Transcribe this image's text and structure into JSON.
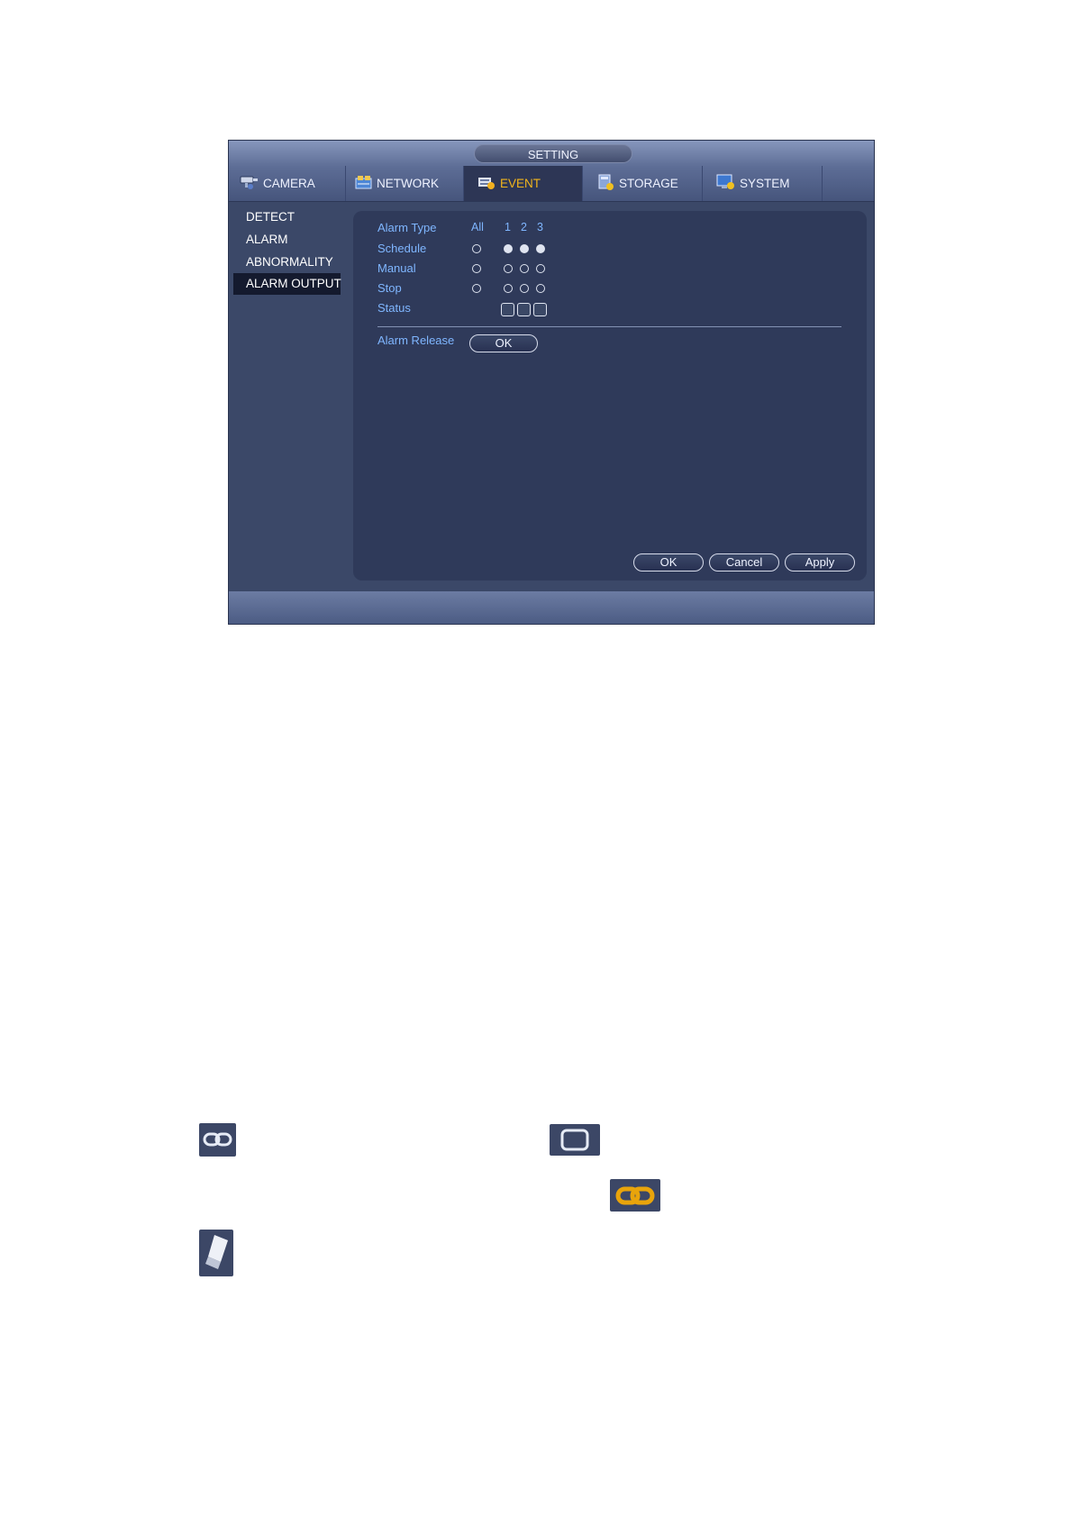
{
  "window": {
    "title": "SETTING"
  },
  "tabs": [
    {
      "label": "CAMERA",
      "icon": "camera-icon"
    },
    {
      "label": "NETWORK",
      "icon": "network-icon"
    },
    {
      "label": "EVENT",
      "icon": "event-icon",
      "active": true
    },
    {
      "label": "STORAGE",
      "icon": "storage-icon"
    },
    {
      "label": "SYSTEM",
      "icon": "system-icon"
    }
  ],
  "sidebar": {
    "items": [
      {
        "label": "DETECT"
      },
      {
        "label": "ALARM"
      },
      {
        "label": "ABNORMALITY"
      },
      {
        "label": "ALARM OUTPUT",
        "active": true
      }
    ]
  },
  "alarm_output": {
    "header": {
      "label": "Alarm Type",
      "all": "All",
      "channels": [
        "1",
        "2",
        "3"
      ]
    },
    "rows": [
      {
        "label": "Schedule",
        "all_selected": false,
        "channels_selected": [
          true,
          true,
          true
        ]
      },
      {
        "label": "Manual",
        "all_selected": false,
        "channels_selected": [
          false,
          false,
          false
        ]
      },
      {
        "label": "Stop",
        "all_selected": false,
        "channels_selected": [
          false,
          false,
          false
        ]
      }
    ],
    "status": {
      "label": "Status",
      "channels_checked": [
        false,
        false,
        false
      ]
    },
    "alarm_release": {
      "label": "Alarm Release",
      "button": "OK"
    }
  },
  "buttons": {
    "ok": "OK",
    "cancel": "Cancel",
    "apply": "Apply"
  },
  "colors": {
    "window_bg": "#3b4868",
    "panel_bg": "#2f3a5a",
    "label_blue": "#7fb6ff",
    "active_tab_text": "#f2b51c",
    "link_icon_active": "#e9a40b"
  },
  "legend_icons": [
    "link-icon",
    "rounded-square-icon",
    "link-active-icon",
    "eraser-icon"
  ]
}
